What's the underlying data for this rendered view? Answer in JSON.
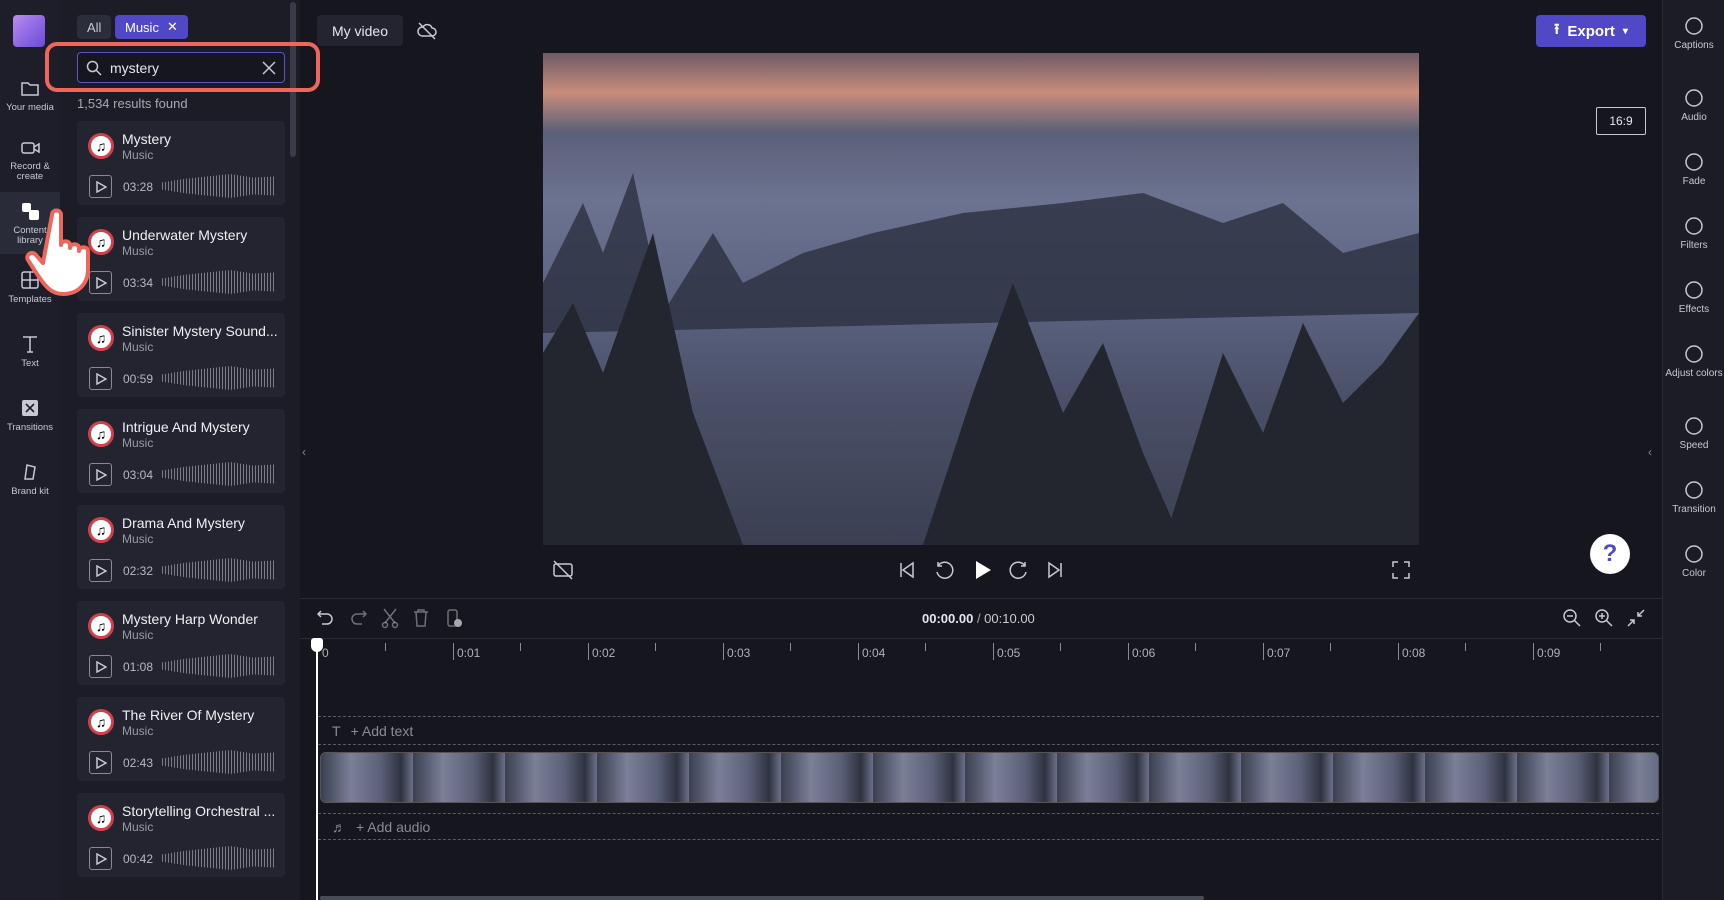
{
  "nav": [
    {
      "label": "Your media",
      "icon": "folder-icon"
    },
    {
      "label": "Record & create",
      "icon": "camera-icon"
    },
    {
      "label": "Content library",
      "icon": "content-library-icon"
    },
    {
      "label": "Templates",
      "icon": "templates-icon"
    },
    {
      "label": "Text",
      "icon": "text-icon"
    },
    {
      "label": "Transitions",
      "icon": "transitions-icon"
    },
    {
      "label": "Brand kit",
      "icon": "brand-kit-icon"
    }
  ],
  "filters": {
    "all": "All",
    "music": "Music"
  },
  "search": {
    "value": "mystery",
    "placeholder": ""
  },
  "results": "1,534 results found",
  "items": [
    {
      "title": "Mystery",
      "type": "Music",
      "duration": "03:28"
    },
    {
      "title": "Underwater Mystery",
      "type": "Music",
      "duration": "03:34"
    },
    {
      "title": "Sinister Mystery Sound...",
      "type": "Music",
      "duration": "00:59"
    },
    {
      "title": "Intrigue And Mystery",
      "type": "Music",
      "duration": "03:04"
    },
    {
      "title": "Drama And Mystery",
      "type": "Music",
      "duration": "02:32"
    },
    {
      "title": "Mystery Harp Wonder",
      "type": "Music",
      "duration": "01:08"
    },
    {
      "title": "The River Of Mystery",
      "type": "Music",
      "duration": "02:43"
    },
    {
      "title": "Storytelling Orchestral ...",
      "type": "Music",
      "duration": "00:42"
    }
  ],
  "project": {
    "title": "My video"
  },
  "export": "Export",
  "ratio": "16:9",
  "right": [
    {
      "label": "Captions"
    },
    {
      "label": "Audio"
    },
    {
      "label": "Fade"
    },
    {
      "label": "Filters"
    },
    {
      "label": "Effects"
    },
    {
      "label": "Adjust colors"
    },
    {
      "label": "Speed"
    },
    {
      "label": "Transition"
    },
    {
      "label": "Color"
    }
  ],
  "help": "?",
  "time": {
    "current": "00:00.00",
    "separator": " / ",
    "total": "00:10.00"
  },
  "ruler": [
    "0",
    "0:01",
    "0:02",
    "0:03",
    "0:04",
    "0:05",
    "0:06",
    "0:07",
    "0:08",
    "0:09"
  ],
  "timeline": {
    "add_text": "+ Add text",
    "add_audio": "+ Add audio"
  },
  "colors": {
    "accent": "#5148c8",
    "highlight": "#f0665a"
  }
}
